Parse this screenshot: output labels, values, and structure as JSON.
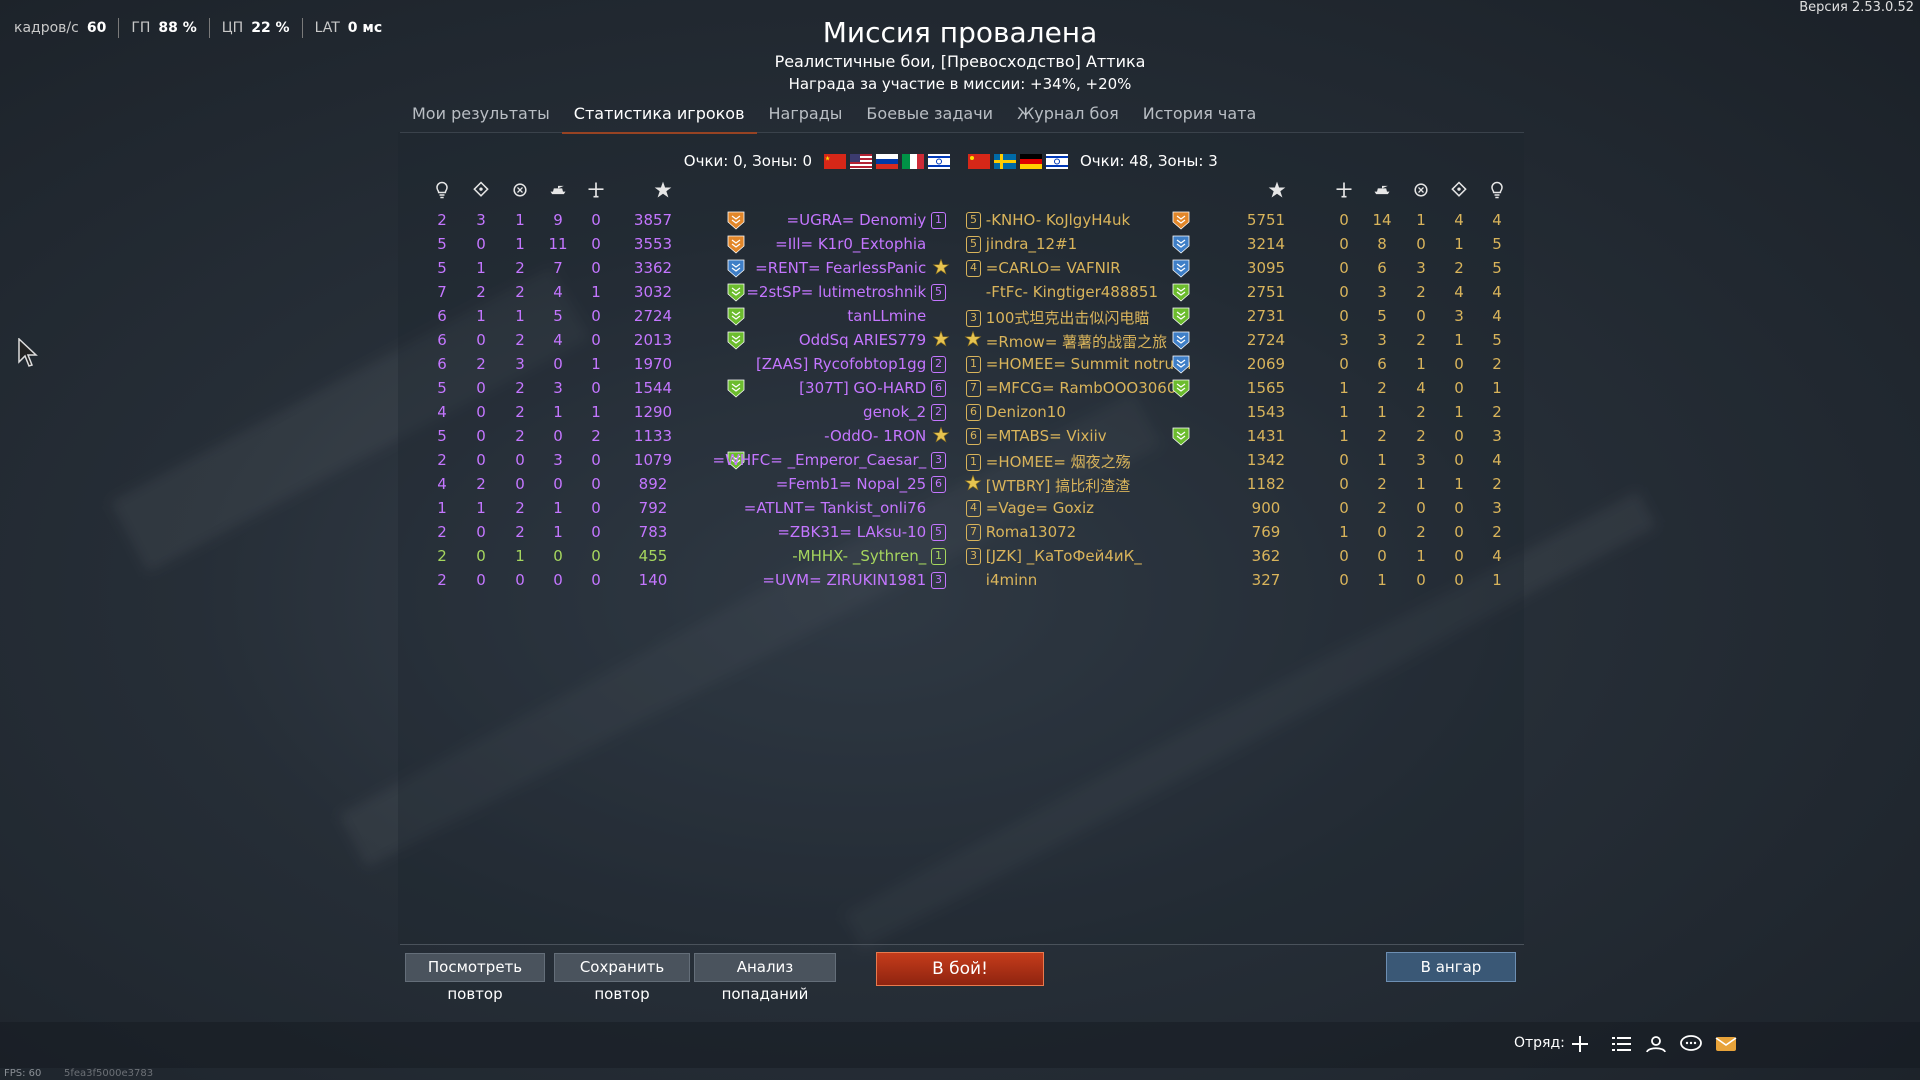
{
  "perf": {
    "fps_label": "кадров/с",
    "fps_value": "60",
    "gpu_label": "ГП",
    "gpu_value": "88 %",
    "cpu_label": "ЦП",
    "cpu_value": "22 %",
    "lat_label": "LAT",
    "lat_value": "0 мс"
  },
  "version": "Версия 2.53.0.52",
  "header": {
    "title": "Миссия провалена",
    "subtitle": "Реалистичные бои, [Превосходство] Аттика",
    "reward": "Награда за участие в миссии: +34%, +20%"
  },
  "tabs": [
    {
      "label": "Мои результаты",
      "active": false
    },
    {
      "label": "Статистика игроков",
      "active": true
    },
    {
      "label": "Награды",
      "active": false
    },
    {
      "label": "Боевые задачи",
      "active": false
    },
    {
      "label": "Журнал боя",
      "active": false
    },
    {
      "label": "История чата",
      "active": false
    }
  ],
  "score": {
    "left": "Очки: 0, Зоны: 0",
    "right": "Очки: 48, Зоны: 3"
  },
  "columns": {
    "icons": [
      "deaths-icon",
      "assists-icon",
      "captures-icon",
      "ground-kills-icon",
      "air-kills-icon",
      "score-icon"
    ]
  },
  "team_left": [
    {
      "deaths": "2",
      "assists": "3",
      "caps": "1",
      "ground": "9",
      "air": "0",
      "score": "3857",
      "name": "=UGRA= Denomiy",
      "level": "1",
      "color": "#c476ff",
      "rank": "orange"
    },
    {
      "deaths": "5",
      "assists": "0",
      "caps": "1",
      "ground": "11",
      "air": "0",
      "score": "3553",
      "name": "=Ill= K1r0_Extophia",
      "level": "",
      "color": "#c476ff",
      "rank": "orange"
    },
    {
      "deaths": "5",
      "assists": "1",
      "caps": "2",
      "ground": "7",
      "air": "0",
      "score": "3362",
      "name": "=RENT= FearlessPanic",
      "level": "",
      "color": "#c476ff",
      "rank": "blue",
      "star": true
    },
    {
      "deaths": "7",
      "assists": "2",
      "caps": "2",
      "ground": "4",
      "air": "1",
      "score": "3032",
      "name": "=2stSP= lutimetroshnik",
      "level": "5",
      "color": "#c476ff",
      "rank": "green"
    },
    {
      "deaths": "6",
      "assists": "1",
      "caps": "1",
      "ground": "5",
      "air": "0",
      "score": "2724",
      "name": "tanLLmine",
      "level": "",
      "color": "#c476ff",
      "rank": "green"
    },
    {
      "deaths": "6",
      "assists": "0",
      "caps": "2",
      "ground": "4",
      "air": "0",
      "score": "2013",
      "name": "OddSq ARIES779",
      "level": "",
      "color": "#c476ff",
      "rank": "green",
      "star": true
    },
    {
      "deaths": "6",
      "assists": "2",
      "caps": "3",
      "ground": "0",
      "air": "1",
      "score": "1970",
      "name": "[ZAAS] Rycofobtop1gg",
      "level": "2",
      "color": "#c476ff",
      "rank": ""
    },
    {
      "deaths": "5",
      "assists": "0",
      "caps": "2",
      "ground": "3",
      "air": "0",
      "score": "1544",
      "name": "[307T] GO-HARD",
      "level": "6",
      "color": "#c476ff",
      "rank": "green"
    },
    {
      "deaths": "4",
      "assists": "0",
      "caps": "2",
      "ground": "1",
      "air": "1",
      "score": "1290",
      "name": "genok_2",
      "level": "2",
      "color": "#c476ff",
      "rank": ""
    },
    {
      "deaths": "5",
      "assists": "0",
      "caps": "2",
      "ground": "0",
      "air": "2",
      "score": "1133",
      "name": "-OddO- 1RON",
      "level": "",
      "color": "#c476ff",
      "rank": "",
      "star": true
    },
    {
      "deaths": "2",
      "assists": "0",
      "caps": "0",
      "ground": "3",
      "air": "0",
      "score": "1079",
      "name": "=WHFC= _Emperor_Caesar_",
      "level": "3",
      "color": "#c476ff",
      "rank": "green"
    },
    {
      "deaths": "4",
      "assists": "2",
      "caps": "0",
      "ground": "0",
      "air": "0",
      "score": "892",
      "name": "=Femb1= Nopal_25",
      "level": "6",
      "color": "#c476ff",
      "rank": ""
    },
    {
      "deaths": "1",
      "assists": "1",
      "caps": "2",
      "ground": "1",
      "air": "0",
      "score": "792",
      "name": "=ATLNT= Tankist_onli76",
      "level": "",
      "color": "#c476ff",
      "rank": ""
    },
    {
      "deaths": "2",
      "assists": "0",
      "caps": "2",
      "ground": "1",
      "air": "0",
      "score": "783",
      "name": "=ZBK31= LAksu-10",
      "level": "5",
      "color": "#c476ff",
      "rank": ""
    },
    {
      "deaths": "2",
      "assists": "0",
      "caps": "1",
      "ground": "0",
      "air": "0",
      "score": "455",
      "name": "-MHHX- _Sythren_",
      "level": "1",
      "color": "#a6d65e",
      "rank": ""
    },
    {
      "deaths": "2",
      "assists": "0",
      "caps": "0",
      "ground": "0",
      "air": "0",
      "score": "140",
      "name": "=UVM= ZIRUKIN1981",
      "level": "3",
      "color": "#c476ff",
      "rank": ""
    }
  ],
  "team_right": [
    {
      "level": "5",
      "name": "-KNHO- KoJlgyH4uk",
      "score": "5751",
      "air": "0",
      "ground": "14",
      "caps": "1",
      "assists": "4",
      "deaths": "4",
      "rank": "orange",
      "color": "#d9b45b"
    },
    {
      "level": "5",
      "name": "jindra_12#1",
      "score": "3214",
      "air": "0",
      "ground": "8",
      "caps": "0",
      "assists": "1",
      "deaths": "5",
      "rank": "blue",
      "color": "#d9b45b"
    },
    {
      "level": "4",
      "name": "=CARLO= VAFNIR",
      "score": "3095",
      "air": "0",
      "ground": "6",
      "caps": "3",
      "assists": "2",
      "deaths": "5",
      "rank": "blue",
      "color": "#d9b45b"
    },
    {
      "level": "",
      "name": "-FtFc- Kingtiger488851",
      "score": "2751",
      "air": "0",
      "ground": "3",
      "caps": "2",
      "assists": "4",
      "deaths": "4",
      "rank": "green",
      "color": "#d9b45b"
    },
    {
      "level": "3",
      "name": "100式坦克出击似闪电瞄",
      "score": "2731",
      "air": "0",
      "ground": "5",
      "caps": "0",
      "assists": "3",
      "deaths": "4",
      "rank": "green",
      "color": "#d9b45b"
    },
    {
      "level": "",
      "name": "=Rmow= 薯薯的战雷之旅",
      "score": "2724",
      "air": "3",
      "ground": "3",
      "caps": "2",
      "assists": "1",
      "deaths": "5",
      "rank": "blue",
      "color": "#d9b45b",
      "star": true
    },
    {
      "level": "1",
      "name": "=HOMEE= Summit notrush",
      "score": "2069",
      "air": "0",
      "ground": "6",
      "caps": "1",
      "assists": "0",
      "deaths": "2",
      "rank": "blue",
      "color": "#d9b45b"
    },
    {
      "level": "7",
      "name": "=MFCG= RambOOO3060",
      "score": "1565",
      "air": "1",
      "ground": "2",
      "caps": "4",
      "assists": "0",
      "deaths": "1",
      "rank": "green",
      "color": "#d9b45b"
    },
    {
      "level": "6",
      "name": "Denizon10",
      "score": "1543",
      "air": "1",
      "ground": "1",
      "caps": "2",
      "assists": "1",
      "deaths": "2",
      "rank": "",
      "color": "#d9b45b"
    },
    {
      "level": "6",
      "name": "=MTABS= Vixiiv",
      "score": "1431",
      "air": "1",
      "ground": "2",
      "caps": "2",
      "assists": "0",
      "deaths": "3",
      "rank": "green",
      "color": "#d9b45b"
    },
    {
      "level": "1",
      "name": "=HOMEE= 烟夜之殇",
      "score": "1342",
      "air": "0",
      "ground": "1",
      "caps": "3",
      "assists": "0",
      "deaths": "4",
      "rank": "",
      "color": "#d9b45b"
    },
    {
      "level": "",
      "name": "[WTBRY] 搞比利渣渣",
      "score": "1182",
      "air": "0",
      "ground": "2",
      "caps": "1",
      "assists": "1",
      "deaths": "2",
      "rank": "",
      "color": "#d9b45b",
      "star": true
    },
    {
      "level": "4",
      "name": "=Vage= Goxiz",
      "score": "900",
      "air": "0",
      "ground": "2",
      "caps": "0",
      "assists": "0",
      "deaths": "3",
      "rank": "",
      "color": "#d9b45b"
    },
    {
      "level": "7",
      "name": "Roma13072",
      "score": "769",
      "air": "1",
      "ground": "0",
      "caps": "2",
      "assists": "0",
      "deaths": "2",
      "rank": "",
      "color": "#d9b45b"
    },
    {
      "level": "3",
      "name": "[JZK] _КаТоФей4иК_",
      "score": "362",
      "air": "0",
      "ground": "0",
      "caps": "1",
      "assists": "0",
      "deaths": "4",
      "rank": "",
      "color": "#d9b45b"
    },
    {
      "level": "",
      "name": "i4minn",
      "score": "327",
      "air": "0",
      "ground": "1",
      "caps": "0",
      "assists": "0",
      "deaths": "1",
      "rank": "",
      "color": "#d9b45b"
    }
  ],
  "buttons": {
    "view_replay": "Посмотреть повтор",
    "save_replay": "Сохранить повтор",
    "hit_analysis": "Анализ попаданий",
    "to_battle": "В бой!",
    "to_hangar": "В ангар"
  },
  "bottom": {
    "squad_label": "Отряд:",
    "fps": "FPS: 60",
    "hash": "5fea3f5000e3783"
  },
  "colors": {
    "accent": "#d9531e",
    "ally_name": "#c476ff",
    "enemy_name": "#d9b45b"
  }
}
